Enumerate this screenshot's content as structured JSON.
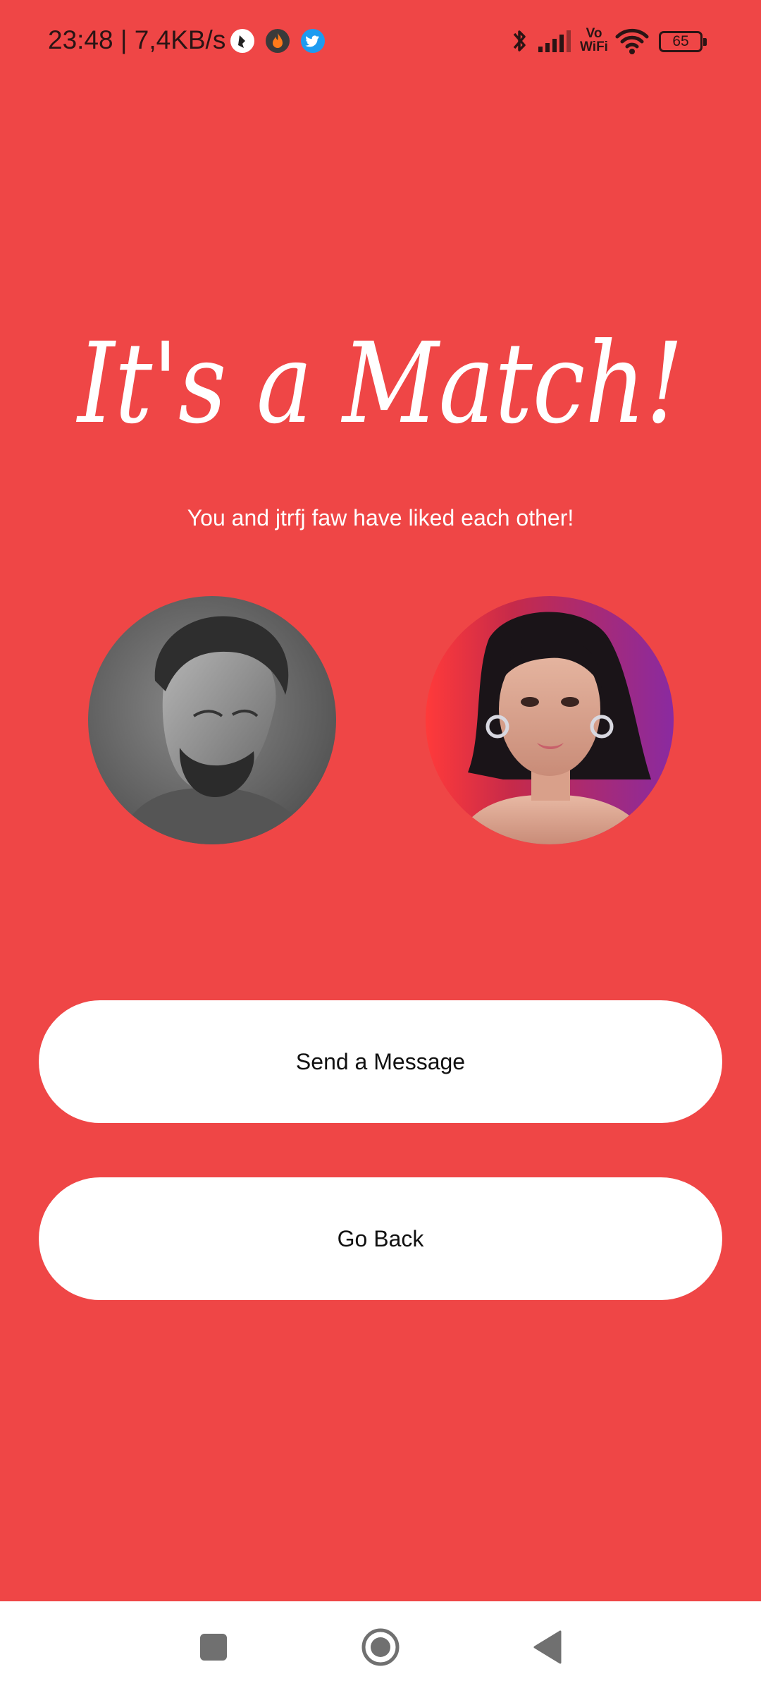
{
  "status_bar": {
    "time_speed": "23:48 | 7,4KB/s",
    "notification_icons": [
      "sound-app-icon",
      "flame-app-icon",
      "twitter-icon"
    ],
    "system_icons": [
      "bluetooth-icon",
      "signal-icon",
      "wifi-icon",
      "battery-icon"
    ],
    "vowifi_top": "Vo",
    "vowifi_bottom": "WiFi",
    "battery_level": "65"
  },
  "match_screen": {
    "title": "It's a Match!",
    "subtitle": "You and jtrfj faw have liked each other!",
    "avatars": [
      "user-avatar",
      "match-avatar"
    ]
  },
  "actions": {
    "send_message_label": "Send a Message",
    "go_back_label": "Go Back"
  },
  "navigation_bar": {
    "buttons": [
      "recents-icon",
      "home-icon",
      "back-icon"
    ]
  },
  "colors": {
    "background": "#ef4646",
    "button": "#ffffff",
    "text_light": "#ffffff",
    "nav_icon": "#707070"
  }
}
